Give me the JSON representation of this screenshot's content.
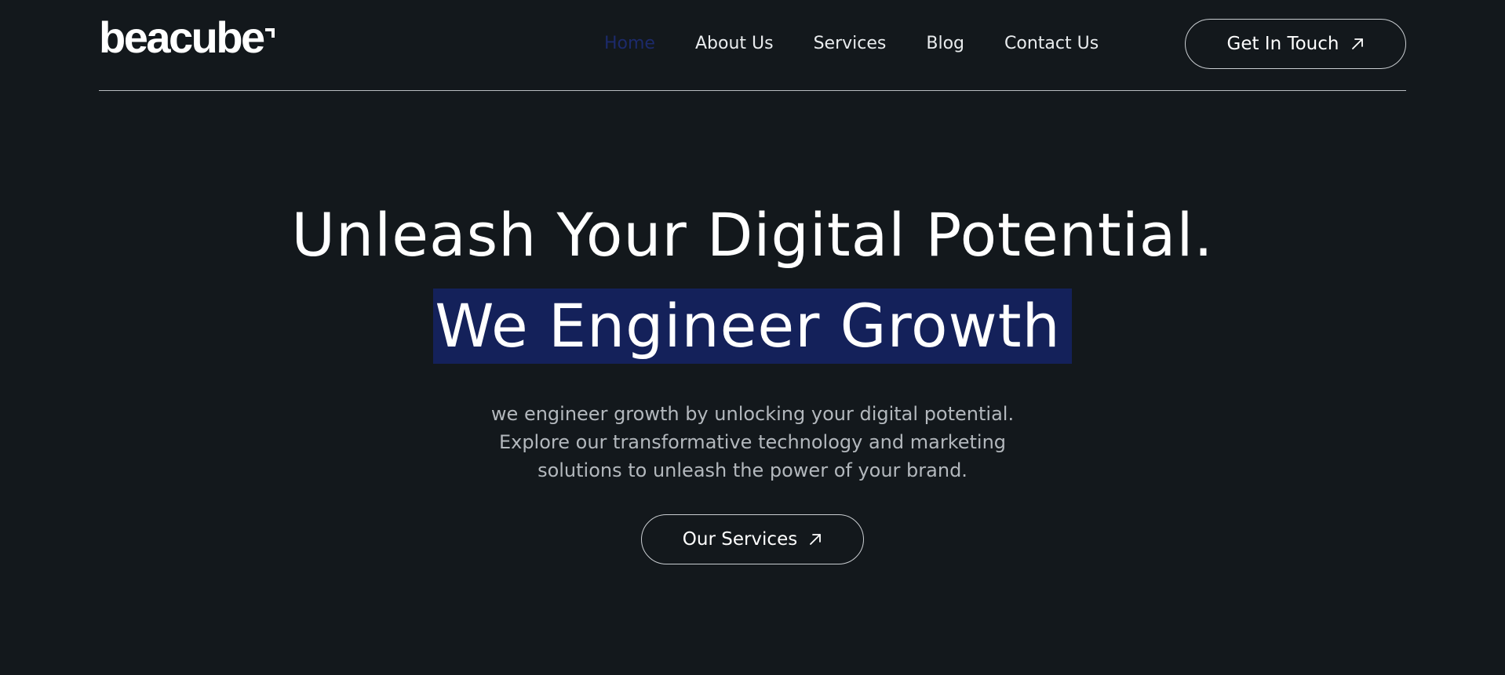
{
  "brand": {
    "logo_text": "beacube"
  },
  "nav": {
    "items": [
      {
        "label": "Home",
        "active": true
      },
      {
        "label": "About Us",
        "active": false
      },
      {
        "label": "Services",
        "active": false
      },
      {
        "label": "Blog",
        "active": false
      },
      {
        "label": "Contact Us",
        "active": false
      }
    ],
    "cta_label": "Get In Touch"
  },
  "hero": {
    "title": "Unleash Your Digital  Potential.",
    "highlight": "We Engineer Growth",
    "description_lines": [
      "we engineer growth by unlocking your digital potential.",
      "Explore our transformative technology and marketing",
      "solutions to unleash the power of your brand."
    ],
    "button_label": "Our Services"
  },
  "colors": {
    "background": "#13181c",
    "highlight_bg": "#14215a",
    "active_nav": "#1c2a6b",
    "muted_text": "#b3b8bd"
  },
  "icons": {
    "cta": "arrow-up-right-icon",
    "services": "arrow-up-right-icon"
  }
}
